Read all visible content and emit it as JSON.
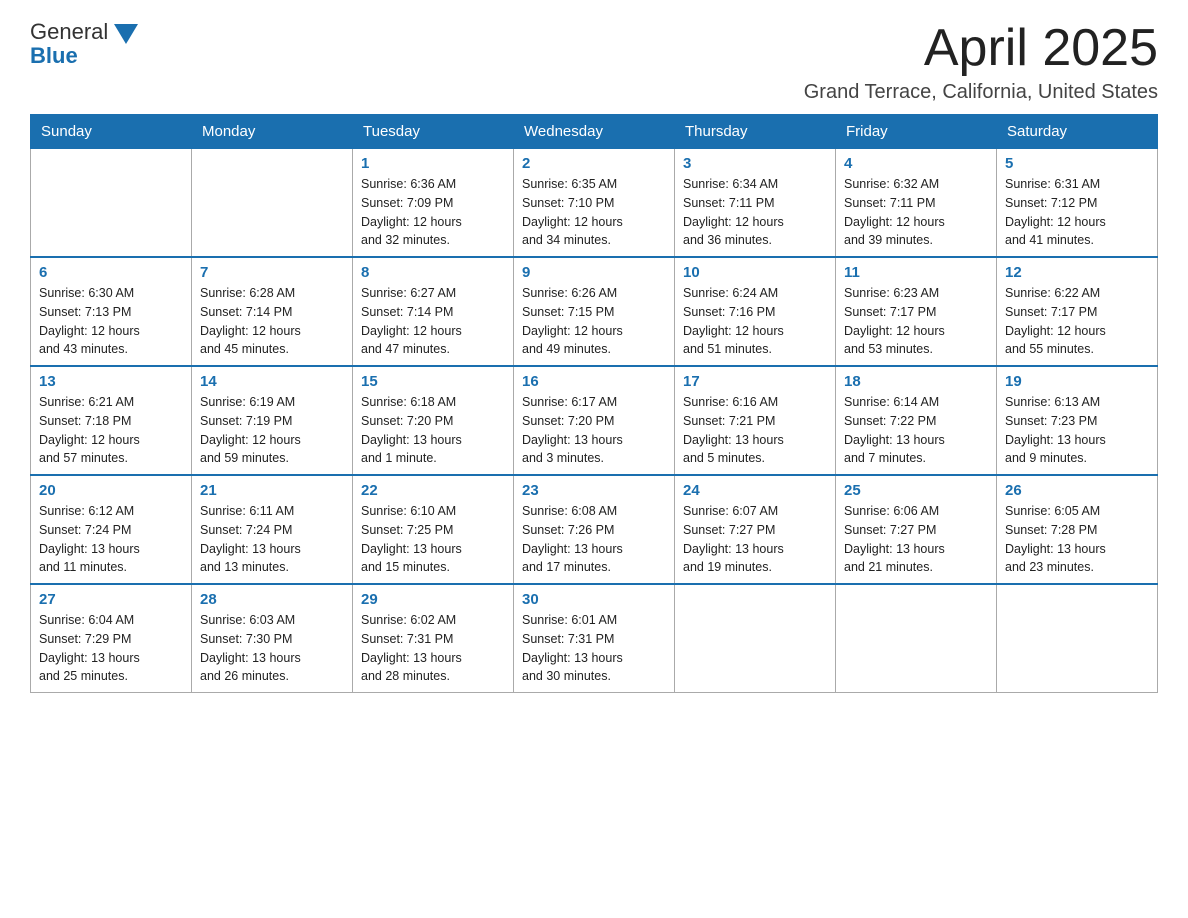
{
  "header": {
    "logo": {
      "general": "General",
      "blue": "Blue"
    },
    "month_title": "April 2025",
    "location": "Grand Terrace, California, United States"
  },
  "calendar": {
    "days_of_week": [
      "Sunday",
      "Monday",
      "Tuesday",
      "Wednesday",
      "Thursday",
      "Friday",
      "Saturday"
    ],
    "weeks": [
      [
        {
          "day": "",
          "info": ""
        },
        {
          "day": "",
          "info": ""
        },
        {
          "day": "1",
          "info": "Sunrise: 6:36 AM\nSunset: 7:09 PM\nDaylight: 12 hours\nand 32 minutes."
        },
        {
          "day": "2",
          "info": "Sunrise: 6:35 AM\nSunset: 7:10 PM\nDaylight: 12 hours\nand 34 minutes."
        },
        {
          "day": "3",
          "info": "Sunrise: 6:34 AM\nSunset: 7:11 PM\nDaylight: 12 hours\nand 36 minutes."
        },
        {
          "day": "4",
          "info": "Sunrise: 6:32 AM\nSunset: 7:11 PM\nDaylight: 12 hours\nand 39 minutes."
        },
        {
          "day": "5",
          "info": "Sunrise: 6:31 AM\nSunset: 7:12 PM\nDaylight: 12 hours\nand 41 minutes."
        }
      ],
      [
        {
          "day": "6",
          "info": "Sunrise: 6:30 AM\nSunset: 7:13 PM\nDaylight: 12 hours\nand 43 minutes."
        },
        {
          "day": "7",
          "info": "Sunrise: 6:28 AM\nSunset: 7:14 PM\nDaylight: 12 hours\nand 45 minutes."
        },
        {
          "day": "8",
          "info": "Sunrise: 6:27 AM\nSunset: 7:14 PM\nDaylight: 12 hours\nand 47 minutes."
        },
        {
          "day": "9",
          "info": "Sunrise: 6:26 AM\nSunset: 7:15 PM\nDaylight: 12 hours\nand 49 minutes."
        },
        {
          "day": "10",
          "info": "Sunrise: 6:24 AM\nSunset: 7:16 PM\nDaylight: 12 hours\nand 51 minutes."
        },
        {
          "day": "11",
          "info": "Sunrise: 6:23 AM\nSunset: 7:17 PM\nDaylight: 12 hours\nand 53 minutes."
        },
        {
          "day": "12",
          "info": "Sunrise: 6:22 AM\nSunset: 7:17 PM\nDaylight: 12 hours\nand 55 minutes."
        }
      ],
      [
        {
          "day": "13",
          "info": "Sunrise: 6:21 AM\nSunset: 7:18 PM\nDaylight: 12 hours\nand 57 minutes."
        },
        {
          "day": "14",
          "info": "Sunrise: 6:19 AM\nSunset: 7:19 PM\nDaylight: 12 hours\nand 59 minutes."
        },
        {
          "day": "15",
          "info": "Sunrise: 6:18 AM\nSunset: 7:20 PM\nDaylight: 13 hours\nand 1 minute."
        },
        {
          "day": "16",
          "info": "Sunrise: 6:17 AM\nSunset: 7:20 PM\nDaylight: 13 hours\nand 3 minutes."
        },
        {
          "day": "17",
          "info": "Sunrise: 6:16 AM\nSunset: 7:21 PM\nDaylight: 13 hours\nand 5 minutes."
        },
        {
          "day": "18",
          "info": "Sunrise: 6:14 AM\nSunset: 7:22 PM\nDaylight: 13 hours\nand 7 minutes."
        },
        {
          "day": "19",
          "info": "Sunrise: 6:13 AM\nSunset: 7:23 PM\nDaylight: 13 hours\nand 9 minutes."
        }
      ],
      [
        {
          "day": "20",
          "info": "Sunrise: 6:12 AM\nSunset: 7:24 PM\nDaylight: 13 hours\nand 11 minutes."
        },
        {
          "day": "21",
          "info": "Sunrise: 6:11 AM\nSunset: 7:24 PM\nDaylight: 13 hours\nand 13 minutes."
        },
        {
          "day": "22",
          "info": "Sunrise: 6:10 AM\nSunset: 7:25 PM\nDaylight: 13 hours\nand 15 minutes."
        },
        {
          "day": "23",
          "info": "Sunrise: 6:08 AM\nSunset: 7:26 PM\nDaylight: 13 hours\nand 17 minutes."
        },
        {
          "day": "24",
          "info": "Sunrise: 6:07 AM\nSunset: 7:27 PM\nDaylight: 13 hours\nand 19 minutes."
        },
        {
          "day": "25",
          "info": "Sunrise: 6:06 AM\nSunset: 7:27 PM\nDaylight: 13 hours\nand 21 minutes."
        },
        {
          "day": "26",
          "info": "Sunrise: 6:05 AM\nSunset: 7:28 PM\nDaylight: 13 hours\nand 23 minutes."
        }
      ],
      [
        {
          "day": "27",
          "info": "Sunrise: 6:04 AM\nSunset: 7:29 PM\nDaylight: 13 hours\nand 25 minutes."
        },
        {
          "day": "28",
          "info": "Sunrise: 6:03 AM\nSunset: 7:30 PM\nDaylight: 13 hours\nand 26 minutes."
        },
        {
          "day": "29",
          "info": "Sunrise: 6:02 AM\nSunset: 7:31 PM\nDaylight: 13 hours\nand 28 minutes."
        },
        {
          "day": "30",
          "info": "Sunrise: 6:01 AM\nSunset: 7:31 PM\nDaylight: 13 hours\nand 30 minutes."
        },
        {
          "day": "",
          "info": ""
        },
        {
          "day": "",
          "info": ""
        },
        {
          "day": "",
          "info": ""
        }
      ]
    ]
  }
}
